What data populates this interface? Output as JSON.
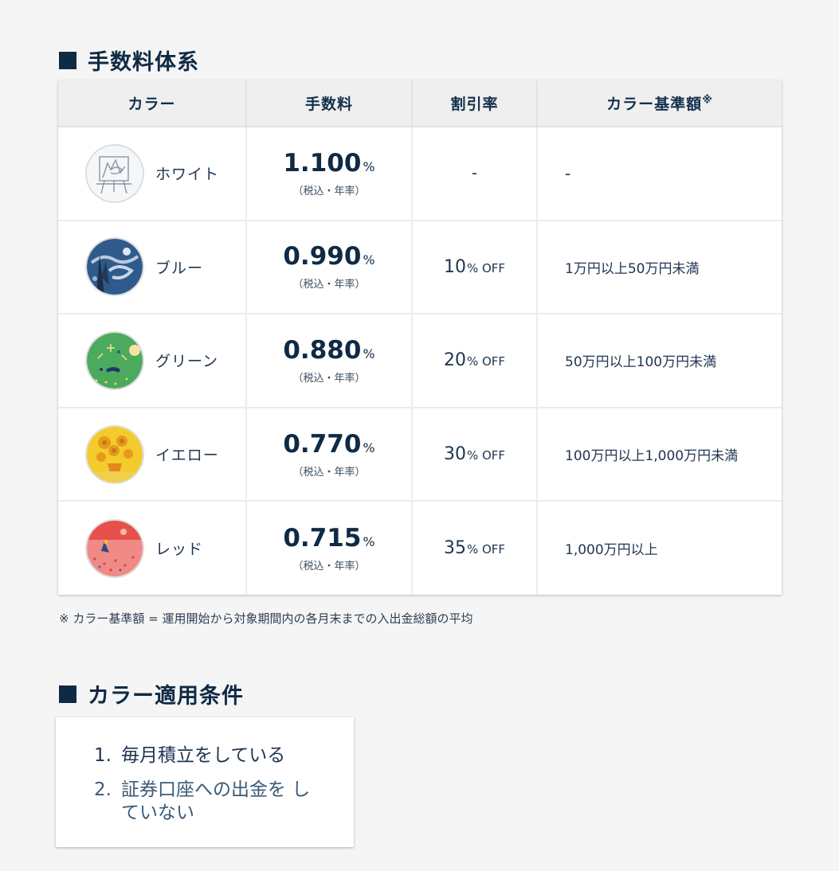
{
  "fee_section": {
    "title": "手数料体系",
    "headers": {
      "color": "カラー",
      "fee": "手数料",
      "discount": "割引率",
      "base": "カラー基準額",
      "base_mark": "※"
    },
    "rows": [
      {
        "color": "ホワイト",
        "fee": "1.100",
        "fee_unit": "%",
        "fee_note": "（税込・年率）",
        "discount": "-",
        "discount_unit": "",
        "base": "-",
        "badge_icon": "white-easel-painting-icon"
      },
      {
        "color": "ブルー",
        "fee": "0.990",
        "fee_unit": "%",
        "fee_note": "（税込・年率）",
        "discount": "10",
        "discount_unit": "% OFF",
        "base": "1万円以上50万円未満",
        "badge_icon": "blue-starry-night-icon"
      },
      {
        "color": "グリーン",
        "fee": "0.880",
        "fee_unit": "%",
        "fee_note": "（税込・年率）",
        "discount": "20",
        "discount_unit": "% OFF",
        "base": "50万円以上100万円未満",
        "badge_icon": "green-fireworks-icon"
      },
      {
        "color": "イエロー",
        "fee": "0.770",
        "fee_unit": "%",
        "fee_note": "（税込・年率）",
        "discount": "30",
        "discount_unit": "% OFF",
        "base": "100万円以上1,000万円未満",
        "badge_icon": "yellow-sunflowers-icon"
      },
      {
        "color": "レッド",
        "fee": "0.715",
        "fee_unit": "%",
        "fee_note": "（税込・年率）",
        "discount": "35",
        "discount_unit": "% OFF",
        "base": "1,000万円以上",
        "badge_icon": "red-sunset-icon"
      }
    ],
    "footnote": "※ カラー基準額 = 運用開始から対象期間内の各月末までの入出金総額の平均"
  },
  "conditions_section": {
    "title": "カラー適用条件",
    "items": [
      {
        "num": "1.",
        "text": "毎月積立をしている"
      },
      {
        "num": "2.",
        "text": "証券口座への出金を していない"
      }
    ]
  },
  "colors": {
    "heading": "#0f2a45",
    "header_bg": "#efefef",
    "white_badge": "#f4f6f8",
    "blue_badge": "#2f5a8c",
    "green_badge": "#4caa5e",
    "yellow_badge": "#f3cb2c",
    "red_badge": "#f08a86"
  }
}
